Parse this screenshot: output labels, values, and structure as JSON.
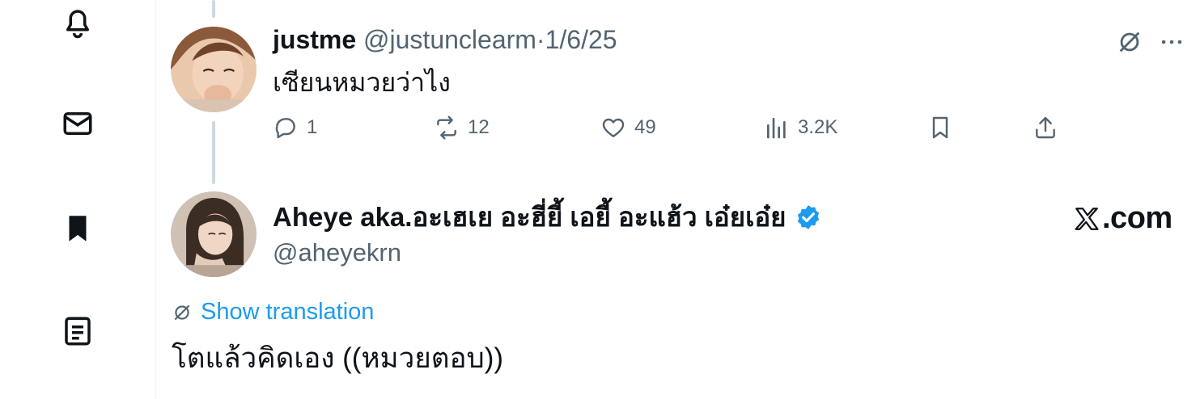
{
  "nav": {
    "items": [
      {
        "icon": "bell-icon"
      },
      {
        "icon": "mail-icon"
      },
      {
        "icon": "bookmark-filled-icon"
      },
      {
        "icon": "list-document-icon"
      }
    ]
  },
  "parent_post": {
    "author_name": "justme",
    "handle": "@justunclearm",
    "separator": "·",
    "date": "1/6/25",
    "text": "เซียนหมวยว่าไง",
    "actions": {
      "replies": "1",
      "reposts": "12",
      "likes": "49",
      "views": "3.2K"
    }
  },
  "reply_post": {
    "author_name": "Aheye aka.อะเฮเย อะฮี่ยี้ เอยี้ อะแฮ้ว เอ๋ยเอ๋ย",
    "handle": "@aheyekrn",
    "verified": true,
    "show_translation_label": "Show translation",
    "text": "โตแล้วคิดเอง ((หมวยตอบ))"
  },
  "watermark": {
    "suffix": ".com"
  },
  "colors": {
    "accent": "#1d9bf0",
    "secondary_text": "#536471",
    "primary_text": "#0f1419",
    "thread_line": "#cfd9de"
  }
}
